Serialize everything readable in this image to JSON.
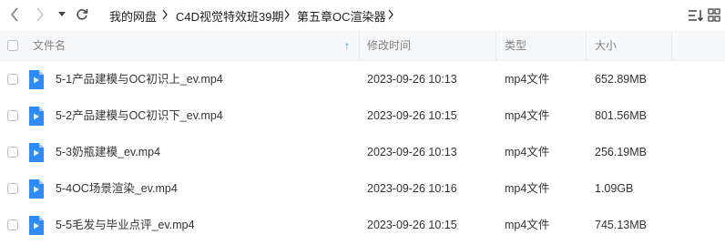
{
  "toolbar": {
    "back_icon": "chevron-left-icon",
    "forward_icon": "chevron-right-icon",
    "history_icon": "caret-down-icon",
    "refresh_icon": "refresh-icon",
    "breadcrumbs": [
      "我的网盘",
      "C4D视觉特效班39期",
      "第五章OC渲染器"
    ],
    "sort_icon": "sort-icon",
    "view_icon": "grid-view-icon"
  },
  "header": {
    "name": "文件名",
    "modified": "修改时间",
    "type": "类型",
    "size": "大小",
    "sort_arrow": "↑"
  },
  "files": [
    {
      "name": "5-1产品建模与OC初识上_ev.mp4",
      "modified": "2023-09-26 10:13",
      "type": "mp4文件",
      "size": "652.89MB"
    },
    {
      "name": "5-2产品建模与OC初识下_ev.mp4",
      "modified": "2023-09-26 10:15",
      "type": "mp4文件",
      "size": "801.56MB"
    },
    {
      "name": "5-3奶瓶建模_ev.mp4",
      "modified": "2023-09-26 10:13",
      "type": "mp4文件",
      "size": "256.19MB"
    },
    {
      "name": "5-4OC场景渲染_ev.mp4",
      "modified": "2023-09-26 10:16",
      "type": "mp4文件",
      "size": "1.09GB"
    },
    {
      "name": "5-5毛发与毕业点评_ev.mp4",
      "modified": "2023-09-26 10:15",
      "type": "mp4文件",
      "size": "745.13MB"
    }
  ],
  "colors": {
    "file_icon": "#2f8cff",
    "sort_arrow": "#2f8cff"
  }
}
